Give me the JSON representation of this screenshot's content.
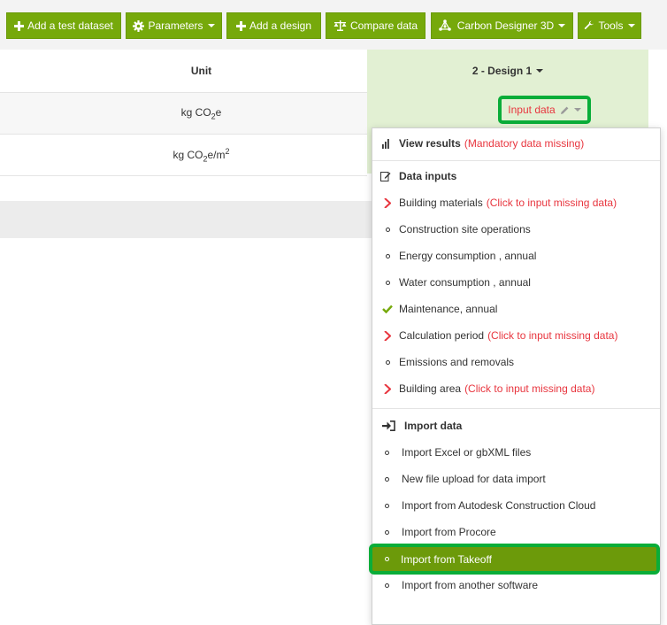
{
  "toolbar": {
    "add_test_dataset": "Add a test dataset",
    "parameters": "Parameters",
    "add_design": "Add a design",
    "compare_data": "Compare data",
    "carbon_designer": "Carbon Designer 3D",
    "tools": "Tools"
  },
  "table": {
    "unit_header": "Unit",
    "design_header": "2 - Design 1",
    "row1_unit": "kg CO",
    "row1_sub": "2",
    "row1_suffix": "e",
    "row2_unit": "kg CO",
    "row2_sub": "2",
    "row2_suffix": "e/m",
    "row2_sup": "2",
    "input_data": "Input data"
  },
  "menu": {
    "view_results": "View results",
    "view_results_note": "(Mandatory data missing)",
    "data_inputs": "Data inputs",
    "items": [
      {
        "label": "Building materials",
        "note": "(Click to input missing data)",
        "status": "missing"
      },
      {
        "label": "Construction site operations",
        "note": "",
        "status": "empty"
      },
      {
        "label": "Energy consumption , annual",
        "note": "",
        "status": "empty"
      },
      {
        "label": "Water consumption , annual",
        "note": "",
        "status": "empty"
      },
      {
        "label": "Maintenance, annual",
        "note": "",
        "status": "done"
      },
      {
        "label": "Calculation period",
        "note": "(Click to input missing data)",
        "status": "missing"
      },
      {
        "label": "Emissions and removals",
        "note": "",
        "status": "empty"
      },
      {
        "label": "Building area",
        "note": "(Click to input missing data)",
        "status": "missing"
      }
    ],
    "import_data": "Import data",
    "import_items": [
      "Import Excel or gbXML files",
      "New file upload for data import",
      "Import from Autodesk Construction Cloud",
      "Import from Procore",
      "Import from Takeoff",
      "Import from another software"
    ]
  },
  "colors": {
    "accent": "#76a90b",
    "highlight_border": "#0aad39",
    "missing": "#e8363f",
    "design_column": "#e2f0d3"
  }
}
